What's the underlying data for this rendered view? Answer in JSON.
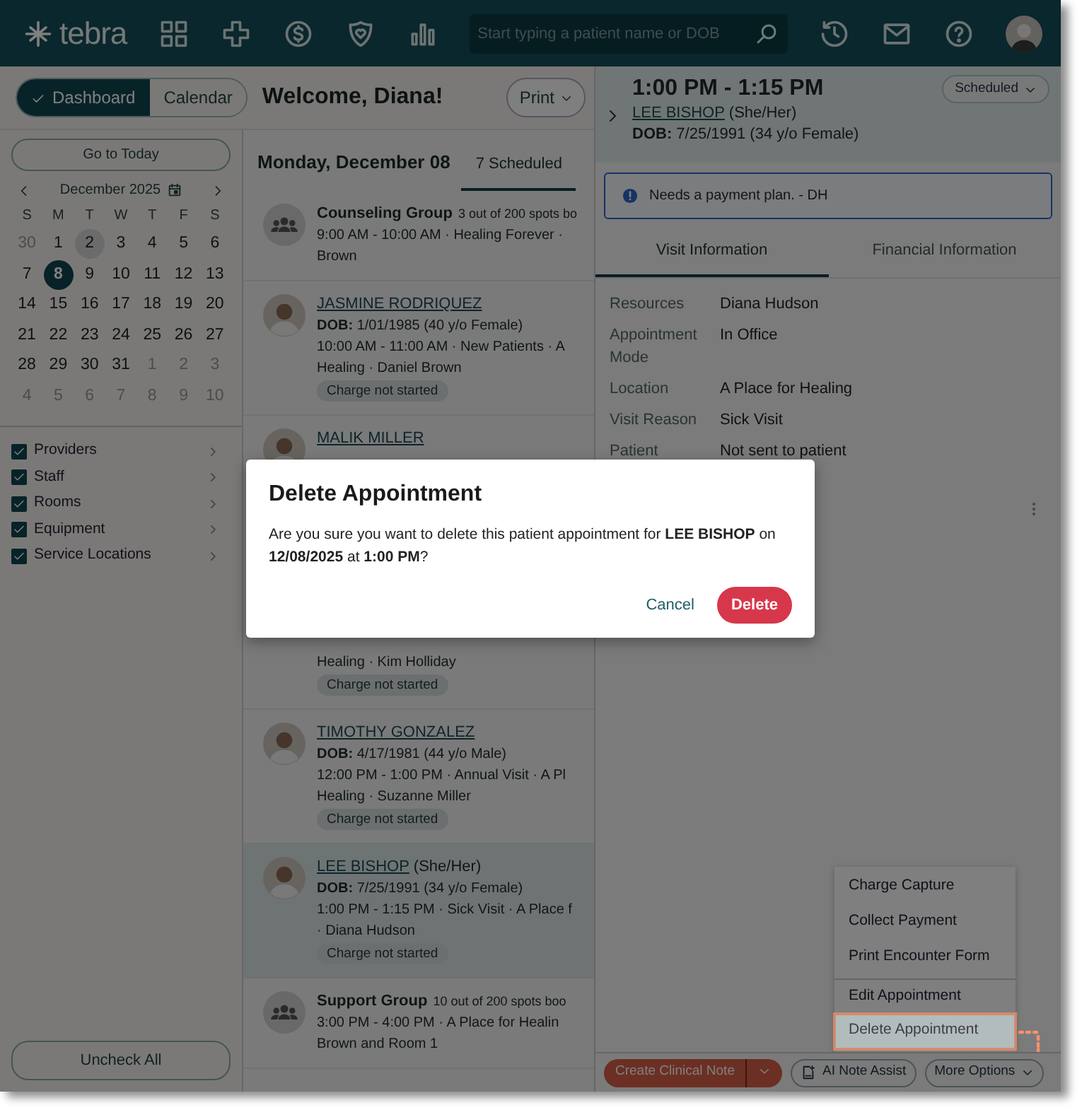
{
  "nav": {
    "logo": "tebra",
    "search": {
      "placeholder": "Start typing a patient name or DOB"
    }
  },
  "view_toggle": [
    {
      "label": "Dashboard",
      "selected": true
    },
    {
      "label": "Calendar",
      "selected": false
    }
  ],
  "welcome": "Welcome, Diana!",
  "print_button": "Print",
  "sidebar": {
    "today_button": "Go to Today",
    "month": "December 2025",
    "weekdays": [
      "S",
      "M",
      "T",
      "W",
      "T",
      "F",
      "S"
    ],
    "weeks": [
      [
        {
          "day": "30",
          "outside": true,
          "today": false,
          "selected": false
        },
        {
          "day": "1",
          "outside": false,
          "today": false,
          "selected": false
        },
        {
          "day": "2",
          "outside": false,
          "today": true,
          "selected": false
        },
        {
          "day": "3",
          "outside": false,
          "today": false,
          "selected": false
        },
        {
          "day": "4",
          "outside": false,
          "today": false,
          "selected": false
        },
        {
          "day": "5",
          "outside": false,
          "today": false,
          "selected": false
        },
        {
          "day": "6",
          "outside": false,
          "today": false,
          "selected": false
        }
      ],
      [
        {
          "day": "7",
          "outside": false,
          "today": false,
          "selected": false
        },
        {
          "day": "8",
          "outside": false,
          "today": false,
          "selected": true
        },
        {
          "day": "9",
          "outside": false,
          "today": false,
          "selected": false
        },
        {
          "day": "10",
          "outside": false,
          "today": false,
          "selected": false
        },
        {
          "day": "11",
          "outside": false,
          "today": false,
          "selected": false
        },
        {
          "day": "12",
          "outside": false,
          "today": false,
          "selected": false
        },
        {
          "day": "13",
          "outside": false,
          "today": false,
          "selected": false
        }
      ],
      [
        {
          "day": "14",
          "outside": false,
          "today": false,
          "selected": false
        },
        {
          "day": "15",
          "outside": false,
          "today": false,
          "selected": false
        },
        {
          "day": "16",
          "outside": false,
          "today": false,
          "selected": false
        },
        {
          "day": "17",
          "outside": false,
          "today": false,
          "selected": false
        },
        {
          "day": "18",
          "outside": false,
          "today": false,
          "selected": false
        },
        {
          "day": "19",
          "outside": false,
          "today": false,
          "selected": false
        },
        {
          "day": "20",
          "outside": false,
          "today": false,
          "selected": false
        }
      ],
      [
        {
          "day": "21",
          "outside": false,
          "today": false,
          "selected": false
        },
        {
          "day": "22",
          "outside": false,
          "today": false,
          "selected": false
        },
        {
          "day": "23",
          "outside": false,
          "today": false,
          "selected": false
        },
        {
          "day": "24",
          "outside": false,
          "today": false,
          "selected": false
        },
        {
          "day": "25",
          "outside": false,
          "today": false,
          "selected": false
        },
        {
          "day": "26",
          "outside": false,
          "today": false,
          "selected": false
        },
        {
          "day": "27",
          "outside": false,
          "today": false,
          "selected": false
        }
      ],
      [
        {
          "day": "28",
          "outside": false,
          "today": false,
          "selected": false
        },
        {
          "day": "29",
          "outside": false,
          "today": false,
          "selected": false
        },
        {
          "day": "30",
          "outside": false,
          "today": false,
          "selected": false
        },
        {
          "day": "31",
          "outside": false,
          "today": false,
          "selected": false
        },
        {
          "day": "1",
          "outside": true,
          "today": false,
          "selected": false
        },
        {
          "day": "2",
          "outside": true,
          "today": false,
          "selected": false
        },
        {
          "day": "3",
          "outside": true,
          "today": false,
          "selected": false
        }
      ],
      [
        {
          "day": "4",
          "outside": true,
          "today": false,
          "selected": false
        },
        {
          "day": "5",
          "outside": true,
          "today": false,
          "selected": false
        },
        {
          "day": "6",
          "outside": true,
          "today": false,
          "selected": false
        },
        {
          "day": "7",
          "outside": true,
          "today": false,
          "selected": false
        },
        {
          "day": "8",
          "outside": true,
          "today": false,
          "selected": false
        },
        {
          "day": "9",
          "outside": true,
          "today": false,
          "selected": false
        },
        {
          "day": "10",
          "outside": true,
          "today": false,
          "selected": false
        }
      ]
    ],
    "filters": [
      {
        "label": "Providers",
        "checked": true
      },
      {
        "label": "Staff",
        "checked": true
      },
      {
        "label": "Rooms",
        "checked": true
      },
      {
        "label": "Equipment",
        "checked": true
      },
      {
        "label": "Service Locations",
        "checked": true
      }
    ],
    "uncheck_button": "Uncheck All"
  },
  "schedule": {
    "date": "Monday, December 08",
    "tab": "7 Scheduled",
    "appointments": [
      {
        "kind": "group",
        "title": "Counseling Group",
        "spots": "3 out of 200 spots bo",
        "lines": [
          "9:00 AM - 10:00 AM · Healing Forever ·",
          "Brown"
        ],
        "selected": false,
        "covered": false
      },
      {
        "kind": "patient",
        "name": "JASMINE RODRIQUEZ",
        "dob": "**DOB:** 1/01/1985 (40 y/o Female)",
        "lines": [
          "10:00 AM - 11:00 AM · New Patients · A",
          "Healing · Daniel Brown"
        ],
        "badge": "Charge not started",
        "selected": false,
        "covered": false
      },
      {
        "kind": "patient",
        "name": "MALIK MILLER",
        "lines": [
          "Healing · Kim Holliday"
        ],
        "badge": "Charge not started",
        "selected": false,
        "covered": true
      },
      {
        "kind": "patient",
        "name": "TIMOTHY GONZALEZ",
        "dob": "**DOB:** 4/17/1981 (44 y/o Male)",
        "lines": [
          "12:00 PM - 1:00 PM · Annual Visit · A Pl",
          "Healing · Suzanne Miller"
        ],
        "badge": "Charge not started",
        "selected": false,
        "covered": false
      },
      {
        "kind": "patient",
        "name": "LEE BISHOP",
        "pronouns": "(She/Her)",
        "dob": "**DOB:** 7/25/1991 (34 y/o Female)",
        "lines": [
          "1:00 PM - 1:15 PM · Sick Visit · A Place f",
          "· Diana Hudson"
        ],
        "badge": "Charge not started",
        "selected": true,
        "covered": false
      },
      {
        "kind": "group",
        "title": "Support Group",
        "spots": "10 out of 200 spots boo",
        "lines": [
          "3:00 PM - 4:00 PM · A Place for Healin",
          "Brown and Room 1"
        ],
        "selected": false,
        "covered": false
      }
    ]
  },
  "details": {
    "time": "1:00 PM - 1:15 PM",
    "name": "LEE BISHOP",
    "pronouns": "(She/Her)",
    "dob": "**DOB:** 7/25/1991 (34 y/o Female)",
    "status": "Scheduled",
    "alert": "Needs a payment plan. - DH",
    "tabs": [
      {
        "label": "Visit Information",
        "selected": true
      },
      {
        "label": "Financial Information",
        "selected": false
      }
    ],
    "rows": [
      {
        "label": "Resources",
        "value": "Diana Hudson"
      },
      {
        "label": "Appointment Mode",
        "value": "In Office"
      },
      {
        "label": "Location",
        "value": "A Place for Healing"
      },
      {
        "label": "Visit Reason",
        "value": "Sick Visit"
      },
      {
        "label": "Patient",
        "value": "Not sent to patient"
      }
    ]
  },
  "menu": {
    "items": [
      {
        "label": "Charge Capture",
        "divider_before": false,
        "highlighted": false
      },
      {
        "label": "Collect Payment",
        "divider_before": false,
        "highlighted": false
      },
      {
        "label": "Print Encounter Form",
        "divider_before": false,
        "highlighted": false
      },
      {
        "label": "Edit Appointment",
        "divider_before": true,
        "highlighted": false
      },
      {
        "label": "Delete Appointment",
        "divider_before": false,
        "highlighted": true
      }
    ]
  },
  "footer_buttons": [
    {
      "label": "Create Clinical Note",
      "kind": "split"
    },
    {
      "label": "AI Note Assist",
      "kind": "ai"
    },
    {
      "label": "More Options",
      "kind": "dropdown"
    }
  ],
  "modal": {
    "title": "Delete Appointment",
    "message": "Are you sure you want to delete this patient appointment for **LEE BISHOP** on **12/08/2025** at **1:00 PM**?",
    "buttons": [
      {
        "label": "Cancel",
        "kind": "link"
      },
      {
        "label": "Delete",
        "kind": "danger"
      }
    ]
  }
}
